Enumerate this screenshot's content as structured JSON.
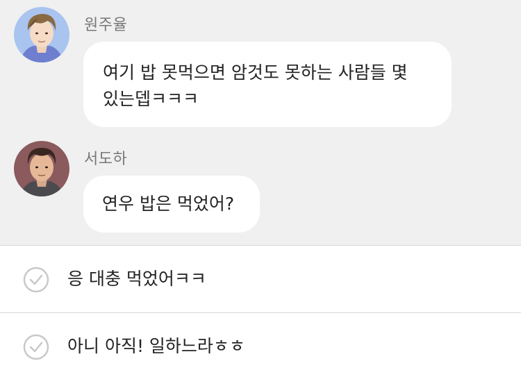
{
  "conversation": {
    "messages": [
      {
        "sender": "원주율",
        "avatar": "male-avatar-light-hair",
        "text_line_1": "여기 밥 못먹으면 암것도 못하는 사람들 몇",
        "text_line_2": "있는뎁ㅋㅋㅋ"
      },
      {
        "sender": "서도하",
        "avatar": "male-avatar-dark-hair",
        "text_line_1": "연우 밥은 먹었어?"
      }
    ]
  },
  "choices": [
    {
      "label": "응 대충 먹었어ㅋㅋ",
      "icon": "check-circle-icon"
    },
    {
      "label": "아니 아직! 일하느라ㅎㅎ",
      "icon": "check-circle-icon"
    }
  ],
  "colors": {
    "chat_background": "#f0f0f0",
    "bubble": "#ffffff",
    "sender_name": "#777777",
    "divider": "#d6d6d6",
    "check_icon": "#c8c8c8"
  }
}
